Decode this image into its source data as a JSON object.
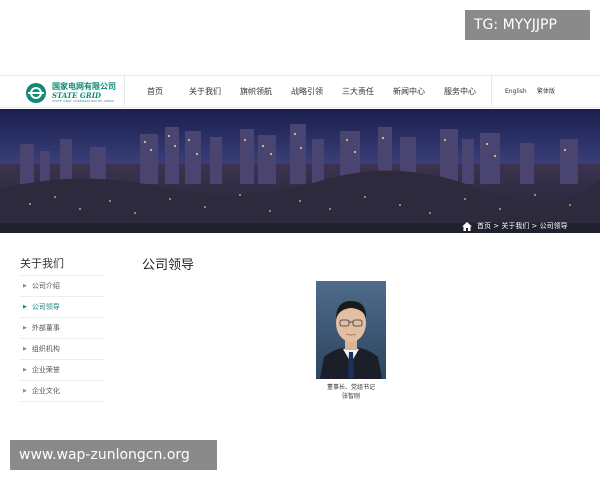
{
  "logo": {
    "name_cn": "国家电网有限公司",
    "name_en": "STATE GRID",
    "name_sub": "STATE GRID CORPORATION OF CHINA"
  },
  "nav": {
    "items": [
      {
        "label": "首页"
      },
      {
        "label": "关于我们"
      },
      {
        "label": "旗帜领航"
      },
      {
        "label": "战略引领"
      },
      {
        "label": "三大责任"
      },
      {
        "label": "新闻中心"
      },
      {
        "label": "服务中心"
      }
    ]
  },
  "lang": {
    "english": "English",
    "traditional": "繁体版"
  },
  "breadcrumb": {
    "home": "首页",
    "sep1": " > ",
    "section": "关于我们",
    "sep2": " > ",
    "current": "公司领导"
  },
  "sidebar": {
    "title": "关于我们",
    "items": [
      {
        "label": "公司介绍",
        "active": false
      },
      {
        "label": "公司领导",
        "active": true
      },
      {
        "label": "外部董事",
        "active": false
      },
      {
        "label": "组织机构",
        "active": false
      },
      {
        "label": "企业荣誉",
        "active": false
      },
      {
        "label": "企业文化",
        "active": false
      }
    ]
  },
  "main": {
    "title": "公司领导",
    "leader": {
      "position": "董事长、党组书记",
      "name": "张智刚"
    }
  },
  "watermarks": {
    "top": "TG: MYYJJPP",
    "bottom": "www.wap-zunlongcn.org"
  },
  "colors": {
    "brand": "#0e8a78",
    "banner_sky": "#1e2452",
    "text": "#333333"
  }
}
